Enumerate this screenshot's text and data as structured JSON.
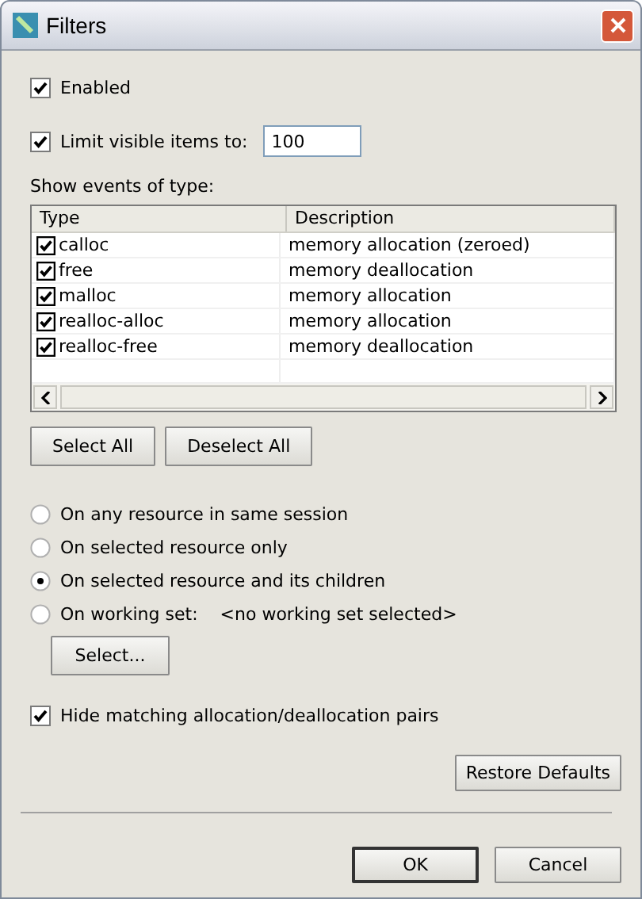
{
  "window": {
    "title": "Filters"
  },
  "enabled": {
    "label": "Enabled",
    "checked": true
  },
  "limit": {
    "label": "Limit visible items to:",
    "checked": true,
    "value": "100"
  },
  "events_label": "Show events of type:",
  "table": {
    "columns": [
      "Type",
      "Description"
    ],
    "rows": [
      {
        "type": "calloc",
        "description": "memory allocation (zeroed)",
        "checked": true
      },
      {
        "type": "free",
        "description": "memory deallocation",
        "checked": true
      },
      {
        "type": "malloc",
        "description": "memory allocation",
        "checked": true
      },
      {
        "type": "realloc-alloc",
        "description": "memory allocation",
        "checked": true
      },
      {
        "type": "realloc-free",
        "description": "memory deallocation",
        "checked": true
      }
    ]
  },
  "table_buttons": [
    "Select All",
    "Deselect All"
  ],
  "scope_options": [
    {
      "label": "On any resource in same session",
      "selected": false
    },
    {
      "label": "On selected resource only",
      "selected": false
    },
    {
      "label": "On selected resource and its children",
      "selected": true
    },
    {
      "label": "On working set:",
      "selected": false,
      "note": "<no working set selected>"
    }
  ],
  "select_button": "Select...",
  "hide_pairs": {
    "label": "Hide matching allocation/deallocation pairs",
    "checked": true
  },
  "restore_button": "Restore Defaults",
  "dialog_buttons": [
    {
      "label": "OK",
      "default": true
    },
    {
      "label": "Cancel",
      "default": false
    }
  ]
}
